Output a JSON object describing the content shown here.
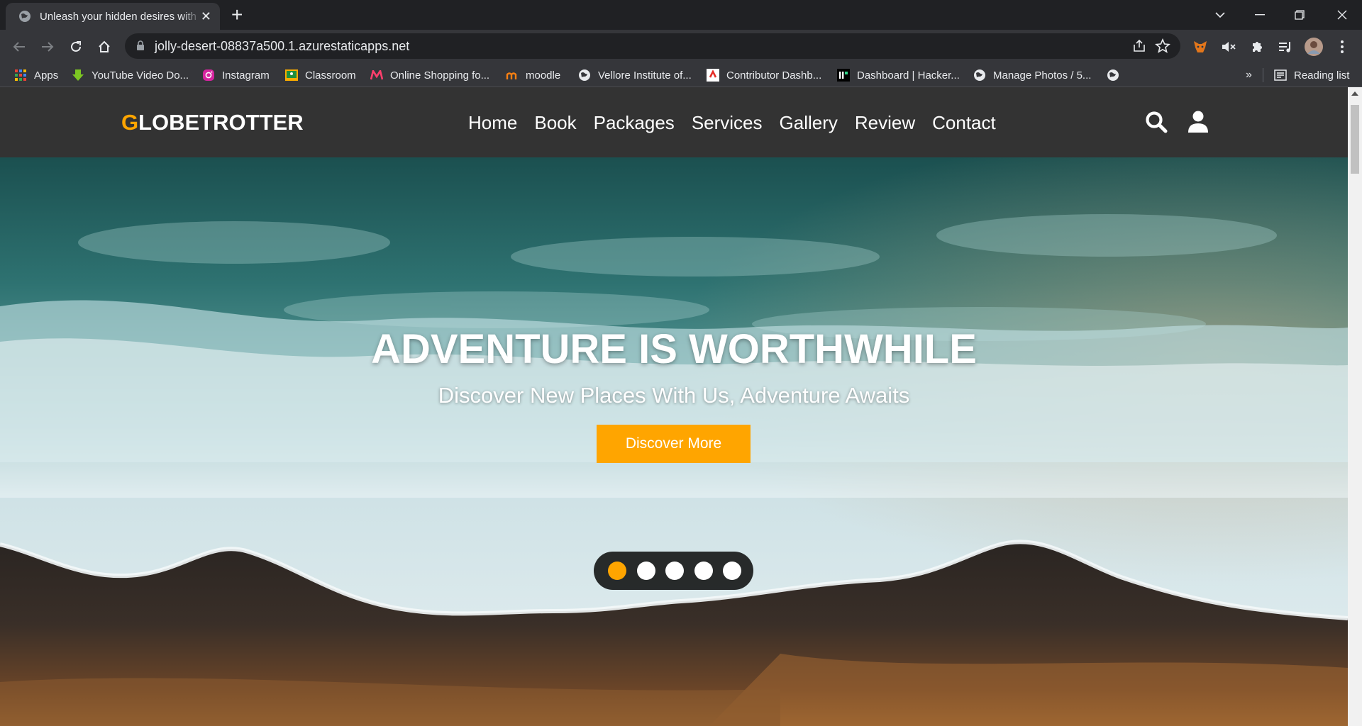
{
  "browser": {
    "tab_title": "Unleash your hidden desires with",
    "url": "jolly-desert-08837a500.1.azurestaticapps.net",
    "bookmarks": [
      {
        "label": "Apps",
        "icon": "apps-grid-icon"
      },
      {
        "label": "YouTube Video Do...",
        "icon": "download-arrow-icon"
      },
      {
        "label": "Instagram",
        "icon": "instagram-icon"
      },
      {
        "label": "Classroom",
        "icon": "classroom-icon"
      },
      {
        "label": "Online Shopping fo...",
        "icon": "myntra-icon"
      },
      {
        "label": "moodle",
        "icon": "moodle-icon"
      },
      {
        "label": "Vellore Institute of...",
        "icon": "globe-icon"
      },
      {
        "label": "Contributor Dashb...",
        "icon": "contributor-icon"
      },
      {
        "label": "Dashboard | Hacker...",
        "icon": "hackerearth-icon"
      },
      {
        "label": "Manage Photos / 5...",
        "icon": "globe-icon"
      }
    ],
    "reading_list": "Reading list",
    "overflow": "»"
  },
  "site": {
    "logo_first": "G",
    "logo_rest": "LOBETROTTER",
    "nav": [
      "Home",
      "Book",
      "Packages",
      "Services",
      "Gallery",
      "Review",
      "Contact"
    ],
    "hero_title": "ADVENTURE IS WORTHWHILE",
    "hero_subtitle": "Discover New Places With Us, Adventure Awaits",
    "cta_label": "Discover More",
    "slider": {
      "count": 5,
      "active": 1
    }
  },
  "colors": {
    "accent": "#ffa500",
    "header_bg": "#333333",
    "chrome_bg": "#35363a",
    "tabstrip_bg": "#202124"
  }
}
